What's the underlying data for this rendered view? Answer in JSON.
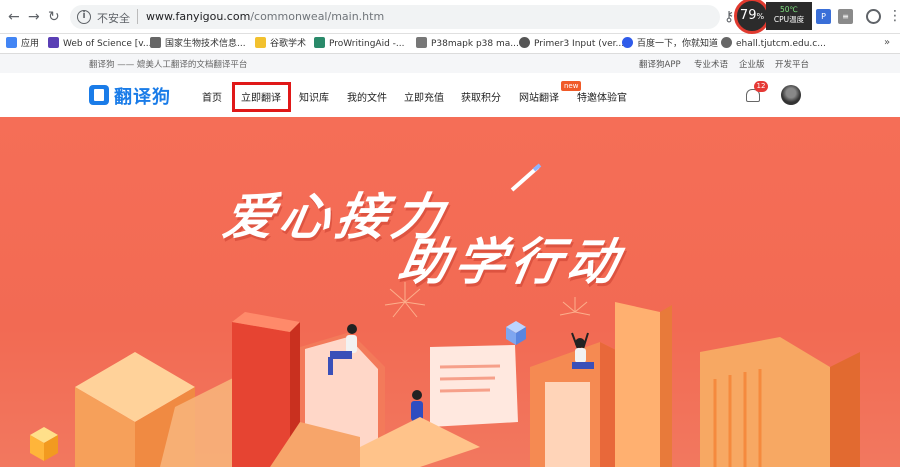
{
  "browser": {
    "url_insecure": "不安全",
    "url_host": "www.fanyigou.com",
    "url_path": "/commonweal/main.htm",
    "cpu": {
      "percent": "79",
      "percent_sign": "%",
      "temp": "50℃",
      "label": "CPU温度"
    },
    "bookmarks": [
      {
        "label": "应用",
        "icon": "apps-grid-icon",
        "color": "#4285f4"
      },
      {
        "label": "Web of Science [v...",
        "icon": "wos-icon",
        "color": "#5a3fb5"
      },
      {
        "label": "国家生物技术信息...",
        "icon": "ncbi-icon",
        "color": "#666666"
      },
      {
        "label": "谷歌学术",
        "icon": "scholar-icon",
        "color": "#f2c12e"
      },
      {
        "label": "ProWritingAid -...",
        "icon": "prowritingaid-icon",
        "color": "#2a8a6a"
      },
      {
        "label": "P38mapk p38 ma...",
        "icon": "p38-icon",
        "color": "#777777"
      },
      {
        "label": "Primer3 Input (ver...",
        "icon": "primer3-icon",
        "color": "#555555"
      },
      {
        "label": "百度一下，你就知道",
        "icon": "baidu-icon",
        "color": "#2f5bea"
      },
      {
        "label": "ehall.tjutcm.edu.c...",
        "icon": "globe-icon",
        "color": "#666666"
      }
    ],
    "bookmarks_more": "»"
  },
  "site": {
    "tagline": "翻译狗 —— 媲美人工翻译的文档翻译平台",
    "top_links": [
      "翻译狗APP",
      "专业术语",
      "企业版",
      "开发平台"
    ],
    "logo_text": "翻译狗",
    "nav": [
      "首页",
      "立即翻译",
      "知识库",
      "我的文件",
      "立即充值",
      "获取积分",
      "网站翻译",
      "特邀体验官"
    ],
    "new_badge": "new",
    "notification_count": "12"
  },
  "banner": {
    "line1": "爱心接力",
    "line2": "助学行动"
  }
}
